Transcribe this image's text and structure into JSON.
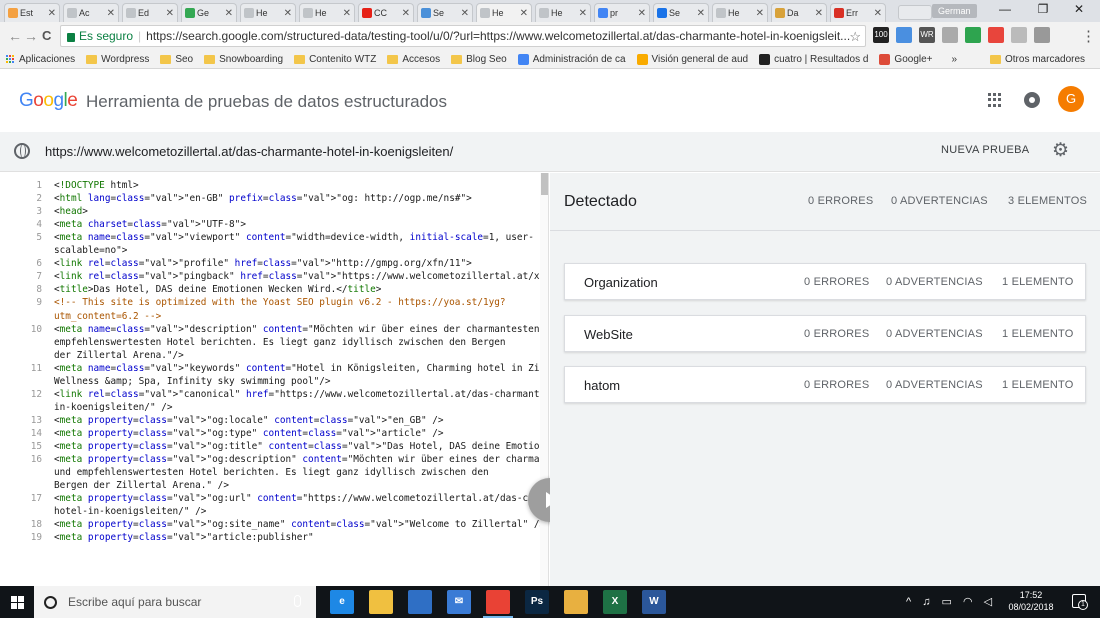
{
  "browser": {
    "tabs": [
      {
        "title": "Est",
        "icon": "orange-favicon-icon",
        "color": "#f4a142"
      },
      {
        "title": "Ac",
        "icon": "document-icon",
        "color": "#c0c4c8"
      },
      {
        "title": "Ed",
        "icon": "document-icon",
        "color": "#c0c4c8"
      },
      {
        "title": "Ge",
        "icon": "drive-icon",
        "color": "#34a853"
      },
      {
        "title": "He",
        "icon": "document-icon",
        "color": "#c0c4c8"
      },
      {
        "title": "He",
        "icon": "document-icon",
        "color": "#c0c4c8"
      },
      {
        "title": "CC",
        "icon": "youtube-icon",
        "color": "#e62117"
      },
      {
        "title": "Se",
        "icon": "search-console-icon",
        "color": "#4a90d9"
      },
      {
        "title": "He",
        "icon": "document-icon",
        "color": "#c0c4c8"
      },
      {
        "title": "He",
        "icon": "document-icon",
        "color": "#c0c4c8"
      },
      {
        "title": "pr",
        "icon": "google-icon",
        "color": "#4285f4"
      },
      {
        "title": "Se",
        "icon": "code-icon",
        "color": "#1a73e8"
      },
      {
        "title": "He",
        "icon": "document-icon",
        "color": "#c0c4c8"
      },
      {
        "title": "Da",
        "icon": "pencil-icon",
        "color": "#d8a23a"
      },
      {
        "title": "Err",
        "icon": "error-icon",
        "color": "#d93025"
      }
    ],
    "active_tab_index": 8,
    "profile_name": "German",
    "window_controls": {
      "minimize": "—",
      "restore": "❐",
      "close": "✕"
    },
    "nav": {
      "back": "←",
      "forward": "→",
      "reload": "C"
    },
    "secure_label": "Es seguro",
    "address": "https://search.google.com/structured-data/testing-tool/u/0/?url=https://www.welcometozillertal.at/das-charmante-hotel-in-koenigsleit...",
    "star": "☆",
    "extensions": [
      {
        "name": "ext-100-icon",
        "label": "100",
        "color": "#222"
      },
      {
        "name": "ext-translate-icon",
        "label": "",
        "color": "#4a8fe0"
      },
      {
        "name": "ext-wr-icon",
        "label": "WR",
        "color": "#555"
      },
      {
        "name": "ext-puzzle-icon",
        "label": "",
        "color": "#aaa"
      },
      {
        "name": "ext-green-circle-icon",
        "label": "",
        "color": "#2ea44f"
      },
      {
        "name": "ext-color-picker-icon",
        "label": "",
        "color": "#e8453c"
      },
      {
        "name": "ext-pdf-icon",
        "label": "",
        "color": "#bbb"
      },
      {
        "name": "ext-settings-icon",
        "label": "",
        "color": "#999"
      }
    ],
    "menu": "⋮"
  },
  "bookmarks": {
    "apps_label": "Aplicaciones",
    "items": [
      {
        "label": "Wordpress",
        "type": "folder"
      },
      {
        "label": "Seo",
        "type": "folder"
      },
      {
        "label": "Snowboarding",
        "type": "folder"
      },
      {
        "label": "Contenito WTZ",
        "type": "folder"
      },
      {
        "label": "Accesos",
        "type": "folder"
      },
      {
        "label": "Blog Seo",
        "type": "folder"
      },
      {
        "label": "Administración de ca",
        "type": "google"
      },
      {
        "label": "Visión general de aud",
        "type": "analytics"
      },
      {
        "label": "cuatro | Resultados d",
        "type": "tv"
      },
      {
        "label": "Google+",
        "type": "gplus"
      }
    ],
    "overflow": "»",
    "other_label": "Otros marcadores"
  },
  "app": {
    "logo_letters": [
      {
        "ch": "G",
        "color": "#4285f4"
      },
      {
        "ch": "o",
        "color": "#ea4335"
      },
      {
        "ch": "o",
        "color": "#fbbc05"
      },
      {
        "ch": "g",
        "color": "#4285f4"
      },
      {
        "ch": "l",
        "color": "#34a853"
      },
      {
        "ch": "e",
        "color": "#ea4335"
      }
    ],
    "title": "Herramienta de pruebas de datos estructurados",
    "avatar_letter": "G",
    "tested_url": "https://www.welcometozillertal.at/das-charmante-hotel-in-koenigsleiten/",
    "new_test_label": "NUEVA PRUEBA",
    "settings_icon": "gear-icon"
  },
  "editor": {
    "lines": [
      {
        "n": "1",
        "text": "<!DOCTYPE html>"
      },
      {
        "n": "2",
        "text": "<html lang=\"en-GB\" prefix=\"og: http://ogp.me/ns#\">"
      },
      {
        "n": "3",
        "text": "<head>"
      },
      {
        "n": "4",
        "text": "<meta charset=\"UTF-8\">"
      },
      {
        "n": "5",
        "text": "<meta name=\"viewport\" content=\"width=device-width, initial-scale=1, user-"
      },
      {
        "n": "",
        "text": "scalable=no\">"
      },
      {
        "n": "6",
        "text": "<link rel=\"profile\" href=\"http://gmpg.org/xfn/11\">"
      },
      {
        "n": "7",
        "text": "<link rel=\"pingback\" href=\"https://www.welcometozillertal.at/xmlrpc.php\">"
      },
      {
        "n": "8",
        "text": "<title>Das Hotel, DAS deine Emotionen Wecken Wird.</title>"
      },
      {
        "n": "9",
        "text": "<!-- This site is optimized with the Yoast SEO plugin v6.2 - https://yoa.st/1yg?"
      },
      {
        "n": "",
        "text": "utm_content=6.2 -->"
      },
      {
        "n": "10",
        "text": "<meta name=\"description\" content=\"Möchten wir über eines der charmantesten und"
      },
      {
        "n": "",
        "text": "empfehlenswertesten Hotel berichten. Es liegt ganz idyllisch zwischen den Bergen"
      },
      {
        "n": "",
        "text": "der Zillertal Arena.\"/>"
      },
      {
        "n": "11",
        "text": "<meta name=\"keywords\" content=\"Hotel in Königsleiten, Charming hotel in Zillertal,"
      },
      {
        "n": "",
        "text": "Wellness &amp; Spa, Infinity sky swimming pool\"/>"
      },
      {
        "n": "12",
        "text": "<link rel=\"canonical\" href=\"https://www.welcometozillertal.at/das-charmante-hotel-"
      },
      {
        "n": "",
        "text": "in-koenigsleiten/\" />"
      },
      {
        "n": "13",
        "text": "<meta property=\"og:locale\" content=\"en_GB\" />"
      },
      {
        "n": "14",
        "text": "<meta property=\"og:type\" content=\"article\" />"
      },
      {
        "n": "15",
        "text": "<meta property=\"og:title\" content=\"Das Hotel, DAS deine Emotionen Wecken Wird.\" />"
      },
      {
        "n": "16",
        "text": "<meta property=\"og:description\" content=\"Möchten wir über eines der charmantesten"
      },
      {
        "n": "",
        "text": "und empfehlenswertesten Hotel berichten. Es liegt ganz idyllisch zwischen den"
      },
      {
        "n": "",
        "text": "Bergen der Zillertal Arena.\" />"
      },
      {
        "n": "17",
        "text": "<meta property=\"og:url\" content=\"https://www.welcometozillertal.at/das-charmante-"
      },
      {
        "n": "",
        "text": "hotel-in-koenigsleiten/\" />"
      },
      {
        "n": "18",
        "text": "<meta property=\"og:site_name\" content=\"Welcome to Zillertal\" />"
      },
      {
        "n": "19",
        "text": "<meta property=\"article:publisher\""
      }
    ]
  },
  "results": {
    "detected_label": "Detectado",
    "summary": {
      "errors": "0 ERRORES",
      "warnings": "0 ADVERTENCIAS",
      "elements": "3 ELEMENTOS"
    },
    "items": [
      {
        "name": "Organization",
        "errors": "0 ERRORES",
        "warnings": "0 ADVERTENCIAS",
        "elements": "1 ELEMENTO"
      },
      {
        "name": "WebSite",
        "errors": "0 ERRORES",
        "warnings": "0 ADVERTENCIAS",
        "elements": "1 ELEMENTO"
      },
      {
        "name": "hatom",
        "errors": "0 ERRORES",
        "warnings": "0 ADVERTENCIAS",
        "elements": "1 ELEMENTO"
      }
    ]
  },
  "taskbar": {
    "search_placeholder": "Escribe aquí para buscar",
    "apps": [
      {
        "name": "edge-icon",
        "label": "e",
        "color": "#1e88e5"
      },
      {
        "name": "file-explorer-icon",
        "label": "",
        "color": "#f0c040"
      },
      {
        "name": "store-icon",
        "label": "",
        "color": "#2f6fc5"
      },
      {
        "name": "mail-icon",
        "label": "✉",
        "color": "#3a7bd5"
      },
      {
        "name": "chrome-icon",
        "label": "",
        "color": "#e94235"
      },
      {
        "name": "photoshop-icon",
        "label": "Ps",
        "color": "#0b2742"
      },
      {
        "name": "folder-icon",
        "label": "",
        "color": "#e8b040"
      },
      {
        "name": "excel-icon",
        "label": "X",
        "color": "#1e7145"
      },
      {
        "name": "word-icon",
        "label": "W",
        "color": "#2b579a"
      }
    ],
    "tray": "^ ♫ ▭ ◠ ◁",
    "time": "17:52",
    "date": "08/02/2018",
    "notification_count": "1"
  }
}
